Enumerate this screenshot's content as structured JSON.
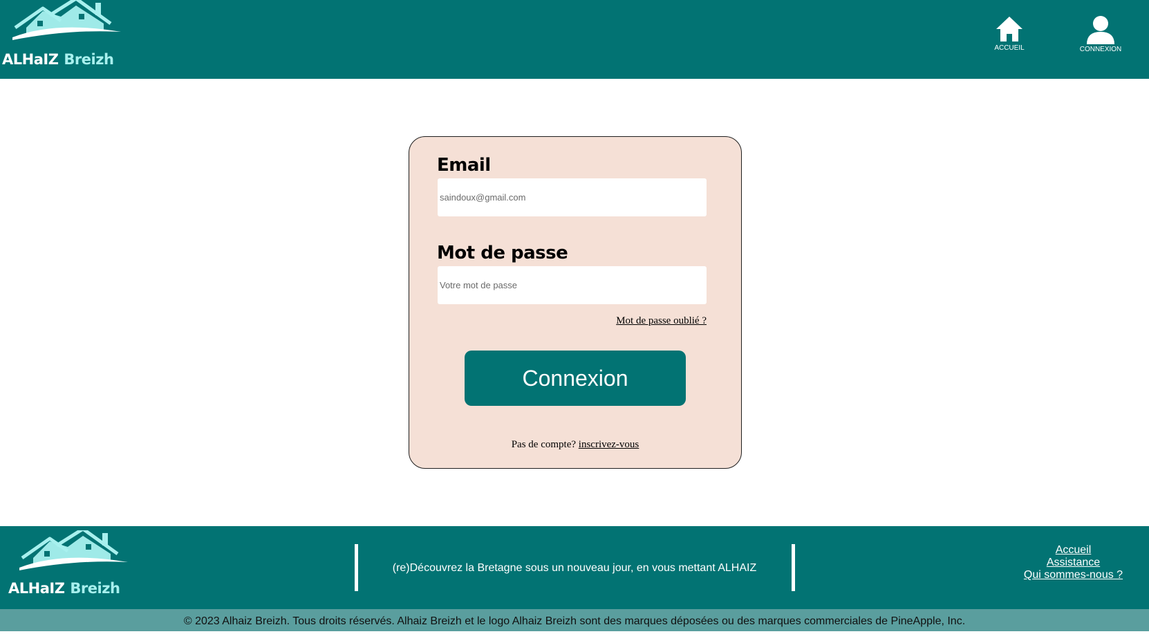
{
  "brand": {
    "name_part1": "ALHaIZ",
    "name_part2": "Breizh",
    "colors": {
      "primary": "#027373",
      "accent": "#a8f0ee",
      "card": "#f5e0d6",
      "bottom_bar": "#5a9e9e"
    }
  },
  "header": {
    "nav": [
      {
        "label": "ACCUEIL",
        "icon": "home-icon"
      },
      {
        "label": "CONNEXION",
        "icon": "user-icon"
      }
    ]
  },
  "login": {
    "email_label": "Email",
    "email_placeholder": "saindoux@gmail.com",
    "password_label": "Mot de passe",
    "password_placeholder": "Votre mot de passe",
    "forgot_link": "Mot de passe oublié ?",
    "submit_label": "Connexion",
    "signup_prompt": "Pas de compte?",
    "signup_link": "inscrivez-vous"
  },
  "footer": {
    "tagline": "(re)Découvrez la Bretagne sous un nouveau jour, en vous mettant ALHAIZ",
    "links": [
      "Accueil",
      "Assistance",
      "Qui sommes-nous ?"
    ],
    "copyright": "© 2023 Alhaiz Breizh. Tous droits réservés. Alhaiz Breizh et le logo Alhaiz Breizh sont des marques déposées ou des marques commerciales de PineApple, Inc."
  }
}
